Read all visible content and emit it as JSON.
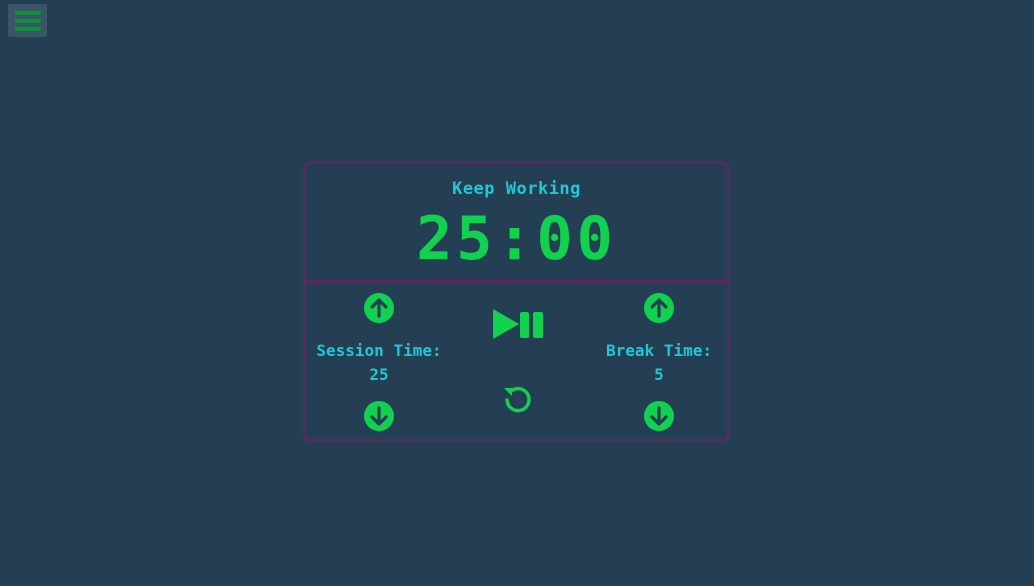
{
  "menu": {
    "icon": "hamburger-menu-icon",
    "color": "#0f8f3a"
  },
  "timer": {
    "status": "Keep Working",
    "clock": "25:00"
  },
  "session": {
    "label": "Session Time:",
    "value": "25"
  },
  "break": {
    "label": "Break Time:",
    "value": "5"
  },
  "icons": {
    "increment": "arrow-up-circle-icon",
    "decrement": "arrow-down-circle-icon",
    "play_pause": "play-pause-icon",
    "reset": "reset-icon"
  },
  "colors": {
    "background": "#243e53",
    "border": "#5a2a5e",
    "accent_green": "#10d24e",
    "text_cyan": "#1ec8d6"
  }
}
